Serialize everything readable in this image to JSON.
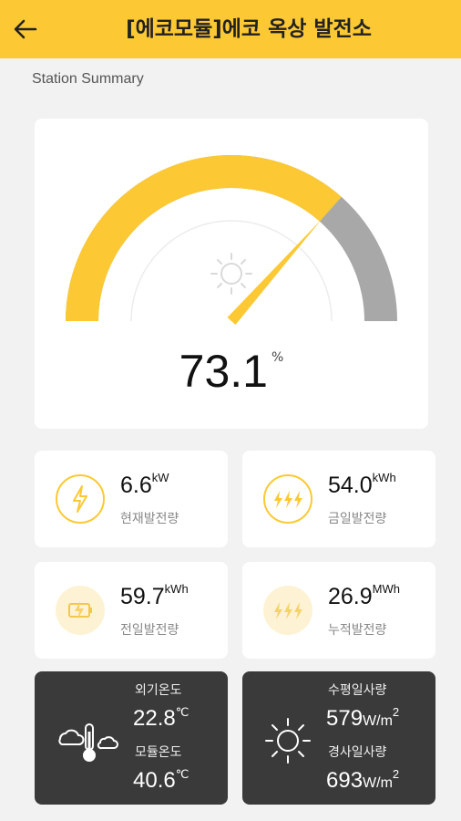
{
  "header": {
    "title": "[에코모듈]에코 옥상 발전소"
  },
  "section_label": "Station Summary",
  "gauge": {
    "value": "73.1",
    "unit": "%",
    "percent": 73.1
  },
  "stats": [
    {
      "value": "6.6",
      "unit": "kW",
      "label": "현재발전량",
      "icon": "lightning-icon"
    },
    {
      "value": "54.0",
      "unit": "kWh",
      "label": "금일발전량",
      "icon": "triple-lightning-icon"
    },
    {
      "value": "59.7",
      "unit": "kWh",
      "label": "전일발전량",
      "icon": "battery-lightning-icon"
    },
    {
      "value": "26.9",
      "unit": "MWh",
      "label": "누적발전량",
      "icon": "triple-lightning-icon"
    }
  ],
  "temperature": {
    "outside_label": "외기온도",
    "outside_value": "22.8",
    "outside_unit": "℃",
    "module_label": "모듈온도",
    "module_value": "40.6",
    "module_unit": "℃"
  },
  "irradiance": {
    "horizontal_label": "수평일사량",
    "horizontal_value": "579",
    "horizontal_unit": "W/m",
    "horizontal_exp": "2",
    "inclined_label": "경사일사량",
    "inclined_value": "693",
    "inclined_unit": "W/m",
    "inclined_exp": "2"
  },
  "colors": {
    "accent": "#fcc934",
    "gauge_remainder": "#a8a8a8",
    "dark_card": "#3a3a3a"
  }
}
